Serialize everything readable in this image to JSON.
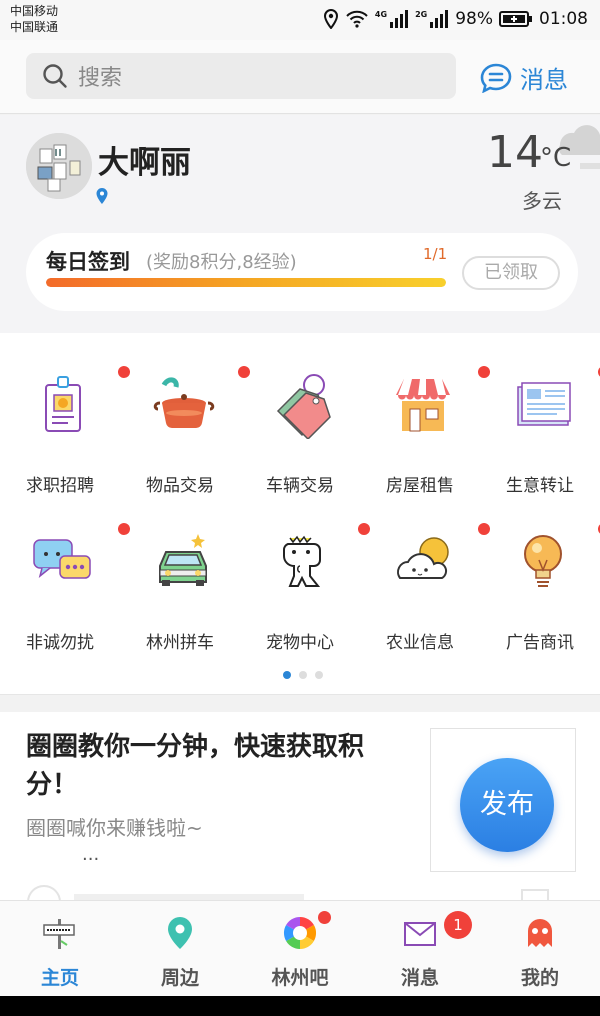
{
  "status_bar": {
    "carrier1": "中国移动",
    "carrier2": "中国联通",
    "net1": "4G",
    "net2": "2G",
    "battery": "98%",
    "time": "01:08"
  },
  "header": {
    "search_placeholder": "搜索",
    "messages_label": "消息",
    "accent_color": "#2b86d6"
  },
  "profile": {
    "username": "大啊丽",
    "temperature": "14",
    "temp_unit": "°C",
    "weather": "多云"
  },
  "checkin": {
    "title": "每日签到",
    "reward": "(奖励8积分,8经验)",
    "count": "1/1",
    "progress_fraction": 1.0,
    "button": "已领取"
  },
  "categories": [
    {
      "label": "求职招聘",
      "icon": "id-badge-icon"
    },
    {
      "label": "物品交易",
      "icon": "cooking-pot-icon"
    },
    {
      "label": "车辆交易",
      "icon": "price-tag-icon"
    },
    {
      "label": "房屋租售",
      "icon": "shop-house-icon"
    },
    {
      "label": "生意转让",
      "icon": "newspaper-icon"
    },
    {
      "label": "非诚勿扰",
      "icon": "chat-bubbles-icon"
    },
    {
      "label": "林州拼车",
      "icon": "car-icon"
    },
    {
      "label": "宠物中心",
      "icon": "pet-dino-icon"
    },
    {
      "label": "农业信息",
      "icon": "cloud-sun-icon"
    },
    {
      "label": "广告商讯",
      "icon": "light-bulb-icon"
    }
  ],
  "pager": {
    "pages": 3,
    "current": 1
  },
  "article": {
    "title": "圈圈教你一分钟，快速获取积分！",
    "subtitle": "圈圈喊你来赚钱啦~",
    "more": "..."
  },
  "fab": {
    "label": "发布"
  },
  "tabs": [
    {
      "label": "主页",
      "icon": "welcome-sign-icon",
      "active": true
    },
    {
      "label": "周边",
      "icon": "map-pin-icon"
    },
    {
      "label": "林州吧",
      "icon": "color-wheel-icon",
      "dot": true
    },
    {
      "label": "消息",
      "icon": "envelope-icon",
      "badge": "1"
    },
    {
      "label": "我的",
      "icon": "ghost-icon"
    }
  ]
}
